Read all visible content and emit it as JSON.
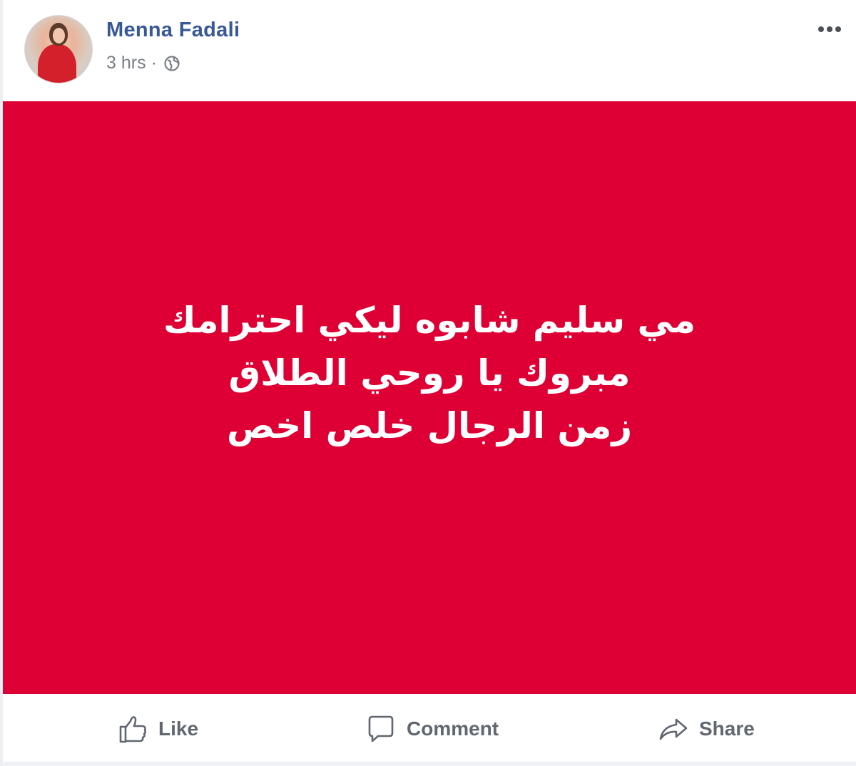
{
  "post": {
    "author_name": "Menna Fadali",
    "timestamp": "3 hrs",
    "separator": "·",
    "privacy_icon": "globe-icon",
    "more_icon": "more-options-icon"
  },
  "image": {
    "background_color": "#de0035",
    "text_color": "#ffffff",
    "lines": [
      "مي سليم شابوه ليكي احترامك",
      "مبروك يا روحي الطلاق",
      "زمن الرجال خلص اخص"
    ]
  },
  "actions": {
    "like_label": "Like",
    "comment_label": "Comment",
    "share_label": "Share",
    "like_icon": "thumbs-up-icon",
    "comment_icon": "comment-bubble-icon",
    "share_icon": "share-arrow-icon"
  },
  "colors": {
    "author_link": "#385898",
    "meta_text": "#7b7f86",
    "action_text": "#606770"
  }
}
